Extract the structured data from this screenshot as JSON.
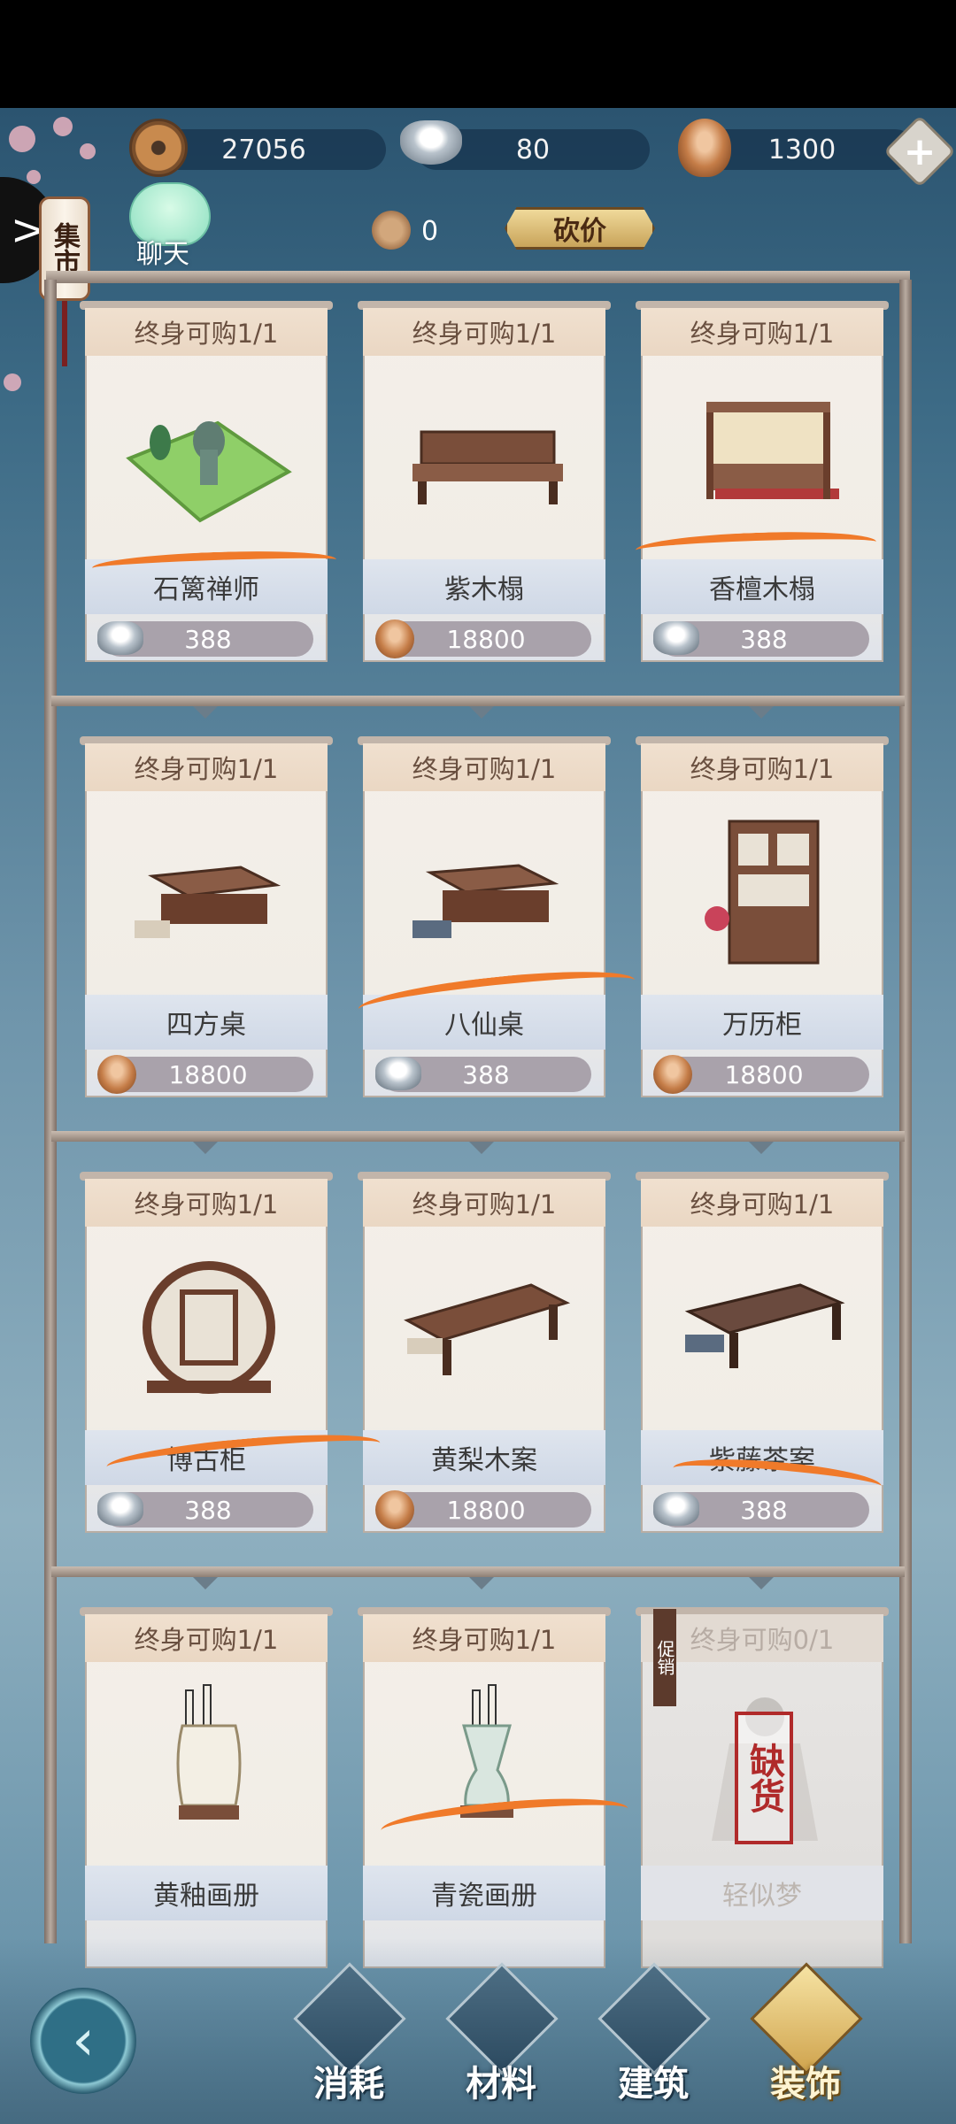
{
  "currency": {
    "coins": "27056",
    "silver": "80",
    "shells": "1300",
    "add_symbol": "+"
  },
  "header": {
    "side_tab_arrow": ">",
    "market_label": "集市",
    "chat_label": "聊天",
    "token_count": "0",
    "bargain_label": "砍价"
  },
  "items": [
    {
      "limit": "终身可购1/1",
      "name": "石篱禅师",
      "price": "388",
      "currency": "silver"
    },
    {
      "limit": "终身可购1/1",
      "name": "紫木榻",
      "price": "18800",
      "currency": "shell"
    },
    {
      "limit": "终身可购1/1",
      "name": "香檀木榻",
      "price": "388",
      "currency": "silver"
    },
    {
      "limit": "终身可购1/1",
      "name": "四方桌",
      "price": "18800",
      "currency": "shell"
    },
    {
      "limit": "终身可购1/1",
      "name": "八仙桌",
      "price": "388",
      "currency": "silver"
    },
    {
      "limit": "终身可购1/1",
      "name": "万历柜",
      "price": "18800",
      "currency": "shell"
    },
    {
      "limit": "终身可购1/1",
      "name": "博古柜",
      "price": "388",
      "currency": "silver"
    },
    {
      "limit": "终身可购1/1",
      "name": "黄梨木案",
      "price": "18800",
      "currency": "shell"
    },
    {
      "limit": "终身可购1/1",
      "name": "紫藤茶案",
      "price": "388",
      "currency": "silver"
    },
    {
      "limit": "终身可购1/1",
      "name": "黄釉画册"
    },
    {
      "limit": "终身可购1/1",
      "name": "青瓷画册"
    },
    {
      "limit": "终身可购0/1",
      "name": "轻似梦",
      "sold_out_stamp": "缺货",
      "ribbon": "促销"
    }
  ],
  "nav": {
    "back_arrow": "‹",
    "tabs": [
      {
        "label": "消耗",
        "icon": "bowl-icon"
      },
      {
        "label": "材料",
        "icon": "bundle-icon"
      },
      {
        "label": "建筑",
        "icon": "pavilion-icon"
      },
      {
        "label": "装饰",
        "icon": "archway-icon",
        "active": true
      }
    ]
  },
  "colors": {
    "accent_orange": "#f07a2a",
    "stamp_red": "#b02a2a",
    "gold": "#d0a44e"
  }
}
